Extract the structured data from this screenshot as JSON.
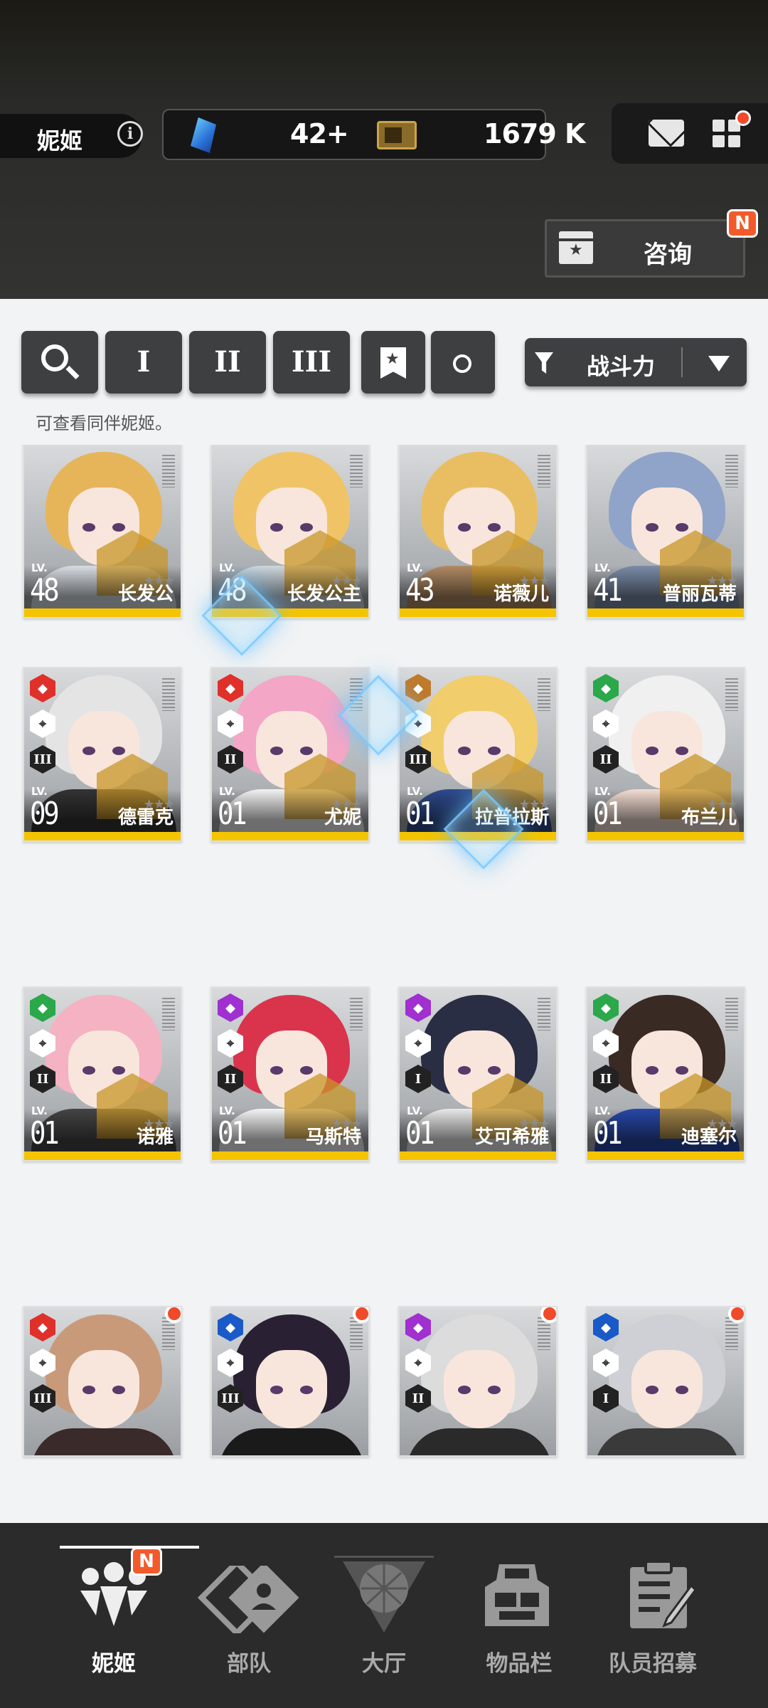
{
  "header": {
    "tag_label": "妮姬",
    "gem_amount": "42+",
    "ticket_amount": "1679 K",
    "consult_label": "咨询",
    "consult_badge": "N"
  },
  "filters": {
    "buttons": [
      "I",
      "II",
      "III"
    ],
    "sort_label": "战斗力",
    "hint": "可查看同伴妮姬。"
  },
  "cards": [
    {
      "lv": "48",
      "name": "长发公",
      "hair": "#e6b55a",
      "cloth": "#d7dde3"
    },
    {
      "lv": "48",
      "name": "长发公主",
      "hair": "#f0c466",
      "cloth": "#cfd8de"
    },
    {
      "lv": "43",
      "name": "诺薇儿",
      "hair": "#e9be63",
      "cloth": "#b08a63"
    },
    {
      "lv": "41",
      "name": "普丽瓦蒂",
      "hair": "#8fa4c8",
      "cloth": "#7a8ca8"
    },
    {
      "lv": "09",
      "name": "德雷克",
      "hair": "#e4e4e4",
      "cloth": "#333"
    },
    {
      "lv": "01",
      "name": "尤妮",
      "hair": "#f4a6c6",
      "cloth": "#f2f2f2"
    },
    {
      "lv": "01",
      "name": "拉普拉斯",
      "hair": "#f2cd6c",
      "cloth": "#2e4a8c"
    },
    {
      "lv": "01",
      "name": "布兰儿",
      "hair": "#f0f0f0",
      "cloth": "#f3ddd2"
    },
    {
      "lv": "01",
      "name": "诺雅",
      "hair": "#f4b2c2",
      "cloth": "#444"
    },
    {
      "lv": "01",
      "name": "马斯特",
      "hair": "#d9344c",
      "cloth": "#f4f4f4"
    },
    {
      "lv": "01",
      "name": "艾可希雅",
      "hair": "#2a2e44",
      "cloth": "#e8e8e8"
    },
    {
      "lv": "01",
      "name": "迪塞尔",
      "hair": "#3a2a24",
      "cloth": "#2848a8"
    },
    {
      "lv": "",
      "name": "",
      "hair": "#c89a7a",
      "cloth": "#3a2a2a"
    },
    {
      "lv": "",
      "name": "",
      "hair": "#2a2034",
      "cloth": "#1a1a1a"
    },
    {
      "lv": "",
      "name": "",
      "hair": "#dcdcdc",
      "cloth": "#2a2a2a"
    },
    {
      "lv": "",
      "name": "",
      "hair": "#cfd0d6",
      "cloth": "#3a3a3a"
    }
  ],
  "element_colors": {
    "fire": "#e0302a",
    "wind": "#2aa84a",
    "electric": "#a030d0",
    "water": "#1a5ac8",
    "iron": "#c07a2a"
  },
  "nav": {
    "items": [
      "妮姬",
      "部队",
      "大厅",
      "物品栏",
      "队员招募"
    ],
    "badge": "N"
  },
  "level_prefix": "LV."
}
